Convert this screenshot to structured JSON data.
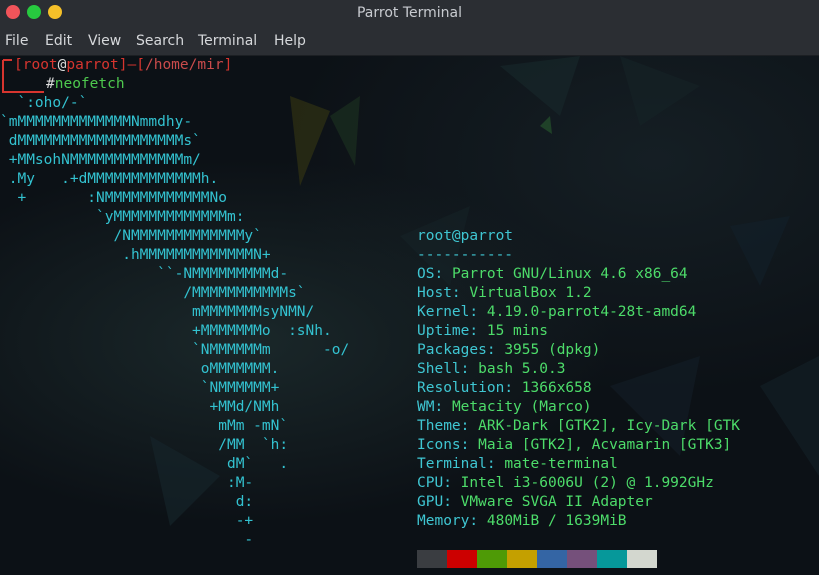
{
  "window": {
    "title": "Parrot Terminal"
  },
  "menu": [
    "File",
    "Edit",
    "View",
    "Search",
    "Terminal",
    "Help"
  ],
  "prompt": {
    "user": "root",
    "at": "@",
    "host": "parrot",
    "dash": "—",
    "path": "/home/mir",
    "symbol": "#",
    "command": "neofetch"
  },
  "ascii_art": [
    "  `:oho/-`",
    "`mMMMMMMMMMMMMMNmmdhy-",
    " dMMMMMMMMMMMMMMMMMMMs`",
    " +MMsohNMMMMMMMMMMMMMm/",
    " .My   .+dMMMMMMMMMMMMMh.",
    "  +       :NMMMMMMMMMMMMNo",
    "           `yMMMMMMMMMMMMMm:",
    "             /NMMMMMMMMMMMMMy`",
    "              .hMMMMMMMMMMMMMN+",
    "                  ``-NMMMMMMMMMd-",
    "                     /MMMMMMMMMMMs`",
    "                      mMMMMMMMsyNMN/",
    "                      +MMMMMMMo  :sNh.",
    "                      `NMMMMMMm      -o/",
    "                       oMMMMMMM.",
    "                       `NMMMMMM+",
    "                        +MMd/NMh",
    "                         mMm -mN`",
    "                         /MM  `h:",
    "                          dM`   .",
    "                          :M-",
    "                           d:",
    "                           -+",
    "                            -"
  ],
  "info": {
    "header": "root@parrot",
    "separator": "-----------",
    "rows": [
      {
        "key": "OS",
        "value": "Parrot GNU/Linux 4.6 x86_64"
      },
      {
        "key": "Host",
        "value": "VirtualBox 1.2"
      },
      {
        "key": "Kernel",
        "value": "4.19.0-parrot4-28t-amd64"
      },
      {
        "key": "Uptime",
        "value": "15 mins"
      },
      {
        "key": "Packages",
        "value": "3955 (dpkg)"
      },
      {
        "key": "Shell",
        "value": "bash 5.0.3"
      },
      {
        "key": "Resolution",
        "value": "1366x658"
      },
      {
        "key": "WM",
        "value": "Metacity (Marco)"
      },
      {
        "key": "Theme",
        "value": "ARK-Dark [GTK2], Icy-Dark [GTK"
      },
      {
        "key": "Icons",
        "value": "Maia [GTK2], Acvamarin [GTK3]"
      },
      {
        "key": "Terminal",
        "value": "mate-terminal"
      },
      {
        "key": "CPU",
        "value": "Intel i3-6006U (2) @ 1.992GHz"
      },
      {
        "key": "GPU",
        "value": "VMware SVGA II Adapter"
      },
      {
        "key": "Memory",
        "value": "480MiB / 1639MiB"
      }
    ]
  },
  "palette": [
    "#3a3d41",
    "#cc0000",
    "#4e9a06",
    "#c4a000",
    "#3465a4",
    "#75507b",
    "#06989a",
    "#d3d7cf"
  ]
}
